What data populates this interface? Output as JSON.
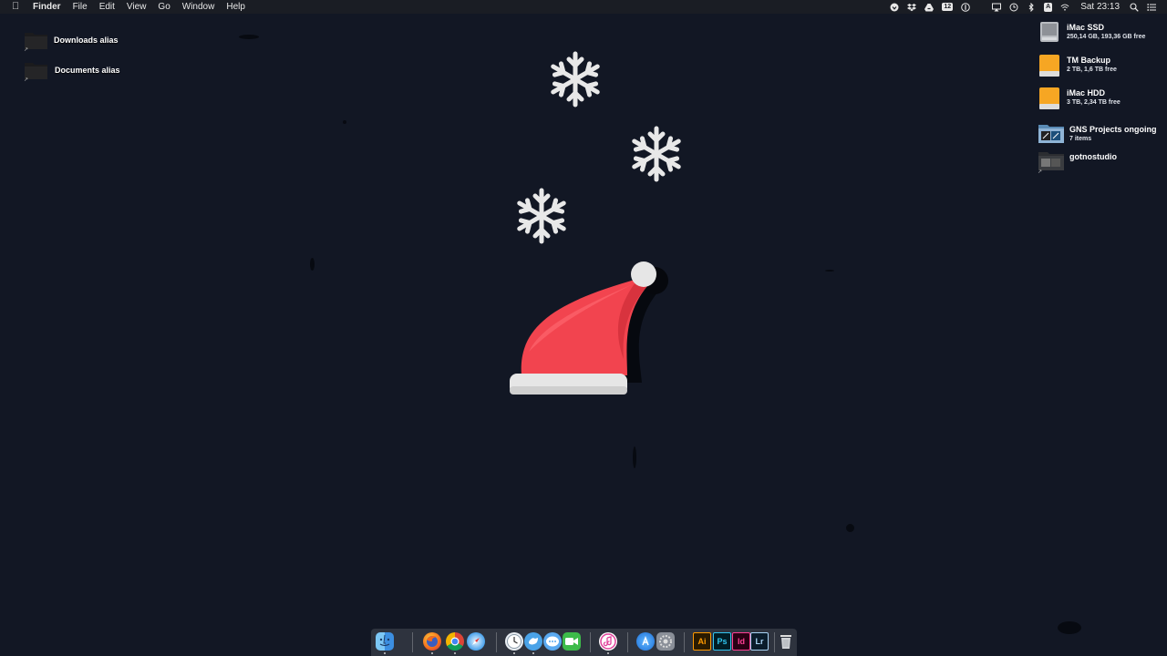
{
  "menubar": {
    "app_name": "Finder",
    "menus": [
      "File",
      "Edit",
      "View",
      "Go",
      "Window",
      "Help"
    ],
    "notification_badge": "12",
    "input_source": "A",
    "clock": "Sat 23:13"
  },
  "desktop_left": [
    {
      "label": "Downloads alias"
    },
    {
      "label": "Documents alias"
    }
  ],
  "desktop_right": [
    {
      "name": "iMac SSD",
      "detail": "250,14 GB, 193,36 GB free"
    },
    {
      "name": "TM Backup",
      "detail": "2 TB, 1,6 TB free"
    },
    {
      "name": "iMac HDD",
      "detail": "3 TB, 2,34 TB free"
    },
    {
      "name": "GNS Projects ongoing",
      "detail": "7 items"
    },
    {
      "name": "gotnostudio",
      "detail": ""
    }
  ],
  "dock": {
    "adobe_labels": {
      "illustrator": "Ai",
      "photoshop": "Ps",
      "indesign": "Id",
      "lightroom": "Lr"
    }
  },
  "colors": {
    "wallpaper": "#121724",
    "hat_red": "#f2444f",
    "hat_trim": "#e6e6e6",
    "snowflake": "#e8e8e8"
  }
}
